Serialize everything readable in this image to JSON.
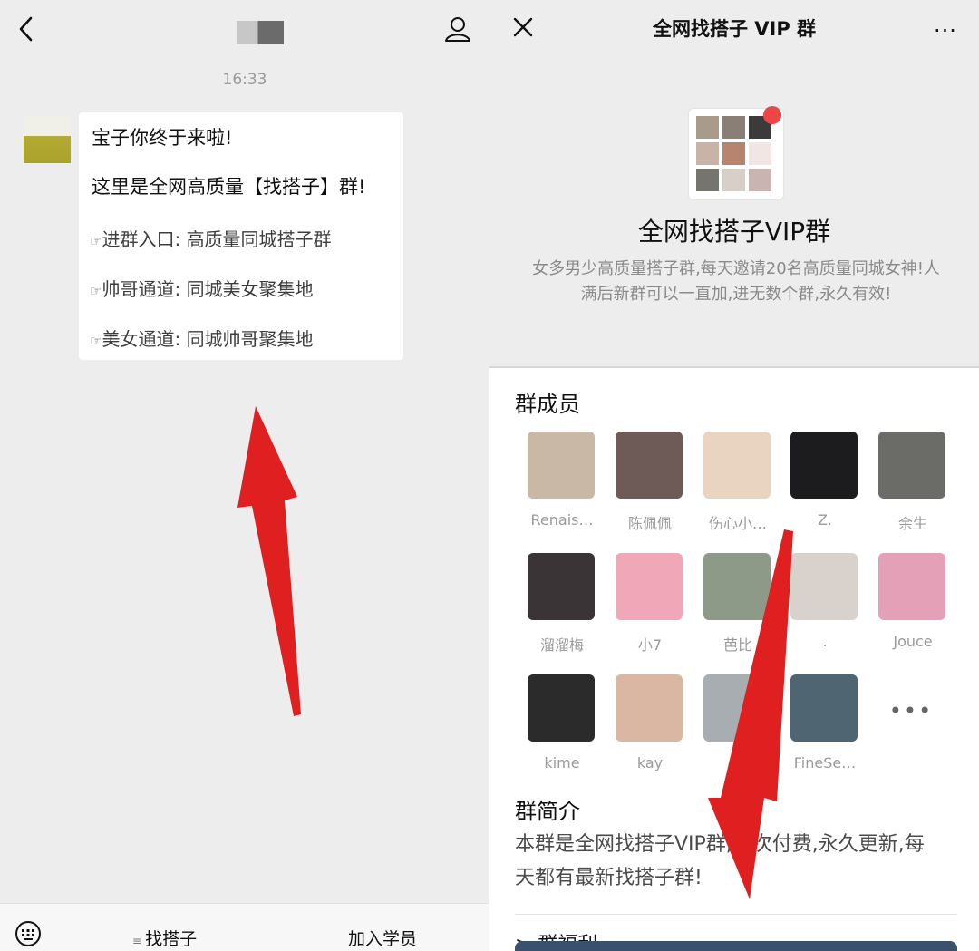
{
  "left_chat": {
    "timestamp": "16:33",
    "message": {
      "greeting": "宝子你终于来啦!",
      "line2_prefix": "这里是全网高质量",
      "line2_keyword": "【找搭子】",
      "line2_suffix": "群!",
      "entries": [
        {
          "icon": "☞",
          "label": "进群入口:",
          "value": "高质量同城搭子群"
        },
        {
          "icon": "☞",
          "label": "帅哥通道:",
          "value": "同城美女聚集地"
        },
        {
          "icon": "☞",
          "label": "美女通道:",
          "value": "同城帅哥聚集地"
        }
      ]
    },
    "footer": {
      "menu1_icon": "≡",
      "menu1": "找搭子",
      "menu2": "加入学员"
    }
  },
  "right_group": {
    "title": "全网找搭子 VIP 群",
    "more": "···",
    "group_name": "全网找搭子VIP群",
    "description_line1": "女多男少高质量搭子群,每天邀请20名高质量同城女神!人",
    "description_line2": "满后新群可以一直加,进无数个群,永久有效!",
    "members_heading": "群成员",
    "members": [
      {
        "name": "Renais…",
        "color": "#c9b8a6"
      },
      {
        "name": "陈佩佩",
        "color": "#6e5a57"
      },
      {
        "name": "伤心小…",
        "color": "#e9d3c1"
      },
      {
        "name": "Z.",
        "color": "#1c1c1e"
      },
      {
        "name": "余生",
        "color": "#6b6b68"
      },
      {
        "name": "溜溜梅",
        "color": "#3b3437"
      },
      {
        "name": "小7",
        "color": "#f0a8b8"
      },
      {
        "name": "芭比",
        "color": "#8e9a88"
      },
      {
        "name": ".",
        "color": "#d9d2cc"
      },
      {
        "name": "Jouce",
        "color": "#e3a0b6"
      },
      {
        "name": "kime",
        "color": "#2b2b2b"
      },
      {
        "name": "kay",
        "color": "#d9b7a3"
      },
      {
        "name": "大",
        "color": "#a8adb1"
      },
      {
        "name": "FineSe…",
        "color": "#4f6572"
      }
    ],
    "more_members": "•••",
    "intro_heading": "群简介",
    "intro_text": "本群是全网找搭子VIP群,一次付费,永久更新,每天都有最新找搭子群!",
    "benefit_heading": "> 群福利",
    "colors": {
      "arrow": "#e02020",
      "badge": "#f04545",
      "bottom_bar": "#39516e"
    }
  }
}
